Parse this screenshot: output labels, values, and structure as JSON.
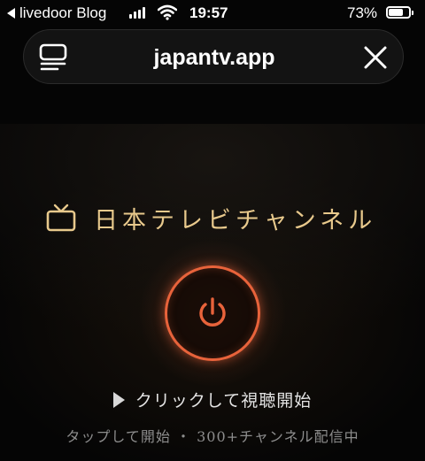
{
  "status_bar": {
    "back_app_label": "livedoor Blog",
    "time": "19:57",
    "battery_percent": "73%",
    "battery_level": 0.73
  },
  "browser": {
    "url": "japantv.app"
  },
  "brand": {
    "title": "日本テレビチャンネル"
  },
  "cta": {
    "label": "クリックして視聴開始"
  },
  "subtitle": "タップして開始 ・ 300+チャンネル配信中",
  "colors": {
    "accent_orange": "#e8633b",
    "brand_gold": "#e8c98c",
    "background": "#050505"
  },
  "icons": {
    "tabs": "tabs-icon",
    "close": "close-icon",
    "tv": "tv-icon",
    "power": "power-icon",
    "play": "play-icon"
  }
}
